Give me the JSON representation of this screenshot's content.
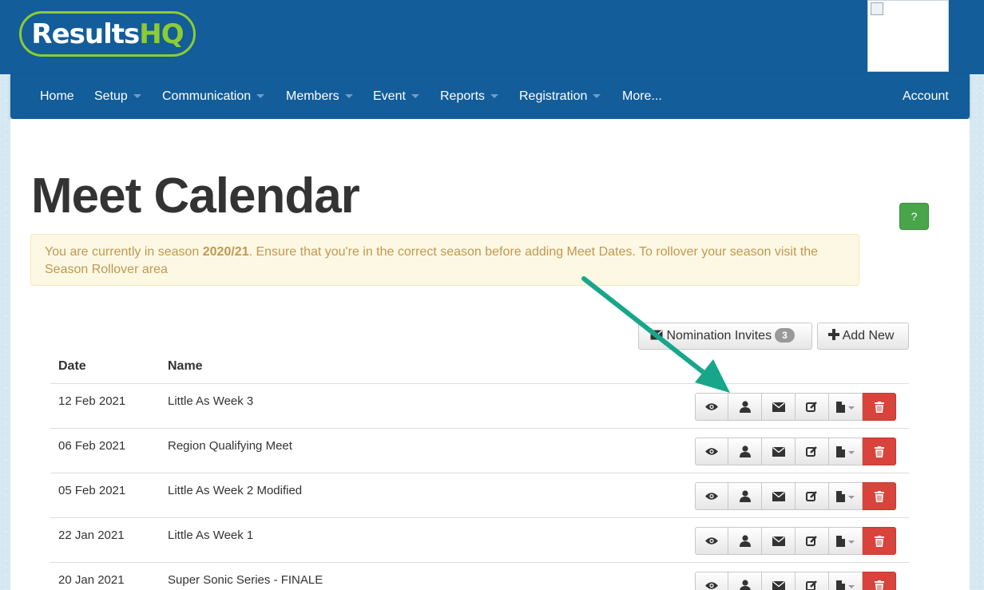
{
  "brand": {
    "logo_part1": "Results",
    "logo_part2": "HQ"
  },
  "nav": {
    "items": [
      "Home",
      "Setup",
      "Communication",
      "Members",
      "Event",
      "Reports",
      "Registration",
      "More..."
    ],
    "account": "Account"
  },
  "page": {
    "title": "Meet Calendar",
    "help": "?",
    "alert": {
      "pre": "You are currently in season ",
      "season": "2020/21",
      "post": ". Ensure that you're in the correct season before adding Meet Dates. To rollover your season visit the Season Rollover area"
    }
  },
  "toolbar": {
    "nomination_label": "Nomination Invites",
    "nomination_count": "3",
    "add_new_label": "Add New"
  },
  "table": {
    "headers": [
      "Date",
      "Name"
    ],
    "rows": [
      {
        "date": "12 Feb 2021",
        "name": "Little As Week 3"
      },
      {
        "date": "06 Feb 2021",
        "name": "Region Qualifying Meet"
      },
      {
        "date": "05 Feb 2021",
        "name": "Little As Week 2 Modified"
      },
      {
        "date": "22 Jan 2021",
        "name": "Little As Week 1"
      },
      {
        "date": "20 Jan 2021",
        "name": "Super Sonic Series - FINALE"
      }
    ]
  },
  "icons": [
    "eye-icon",
    "user-icon",
    "envelope-icon",
    "edit-icon",
    "file-icon",
    "trash-icon"
  ],
  "colors": {
    "brand_blue": "#125d9a",
    "logo_green": "#8dcc33",
    "help_green": "#48a54a",
    "delete_red": "#d9433b",
    "alert_text": "#c09853",
    "arrow": "#17a68a"
  }
}
